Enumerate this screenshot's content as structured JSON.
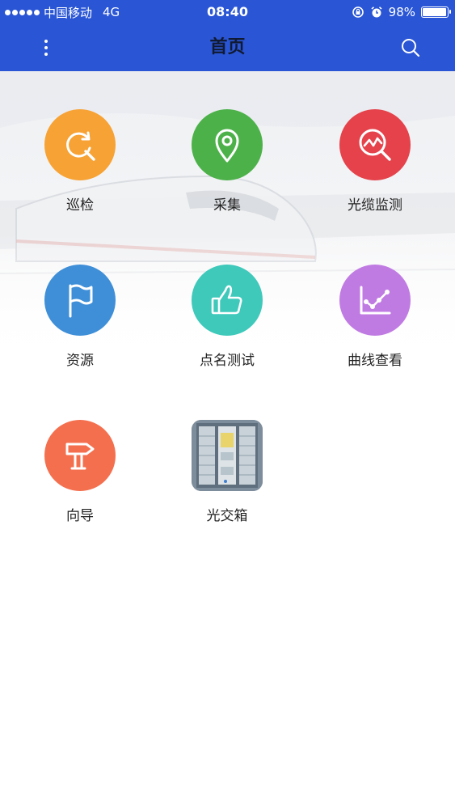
{
  "status_bar": {
    "carrier": "中国移动",
    "network": "4G",
    "time": "08:40",
    "battery_percent": "98%",
    "battery_level": 0.98
  },
  "nav": {
    "title": "首页",
    "menu_icon": "more-vertical-icon",
    "search_icon": "search-icon"
  },
  "grid": {
    "items": [
      {
        "label": "巡检",
        "icon": "patrol-refresh-search-icon",
        "color": "#f7a234"
      },
      {
        "label": "采集",
        "icon": "location-pin-icon",
        "color": "#4db14a"
      },
      {
        "label": "光缆监测",
        "icon": "monitor-chart-search-icon",
        "color": "#e5424b"
      },
      {
        "label": "资源",
        "icon": "flag-icon",
        "color": "#3f8fd8"
      },
      {
        "label": "点名测试",
        "icon": "thumbs-up-icon",
        "color": "#3ec9bb"
      },
      {
        "label": "曲线查看",
        "icon": "line-chart-icon",
        "color": "#c07be3"
      },
      {
        "label": "向导",
        "icon": "signpost-icon",
        "color": "#f46f4e"
      },
      {
        "label": "光交箱",
        "icon": "cabinet-photo-icon",
        "color": "#8a9aa8"
      }
    ]
  }
}
